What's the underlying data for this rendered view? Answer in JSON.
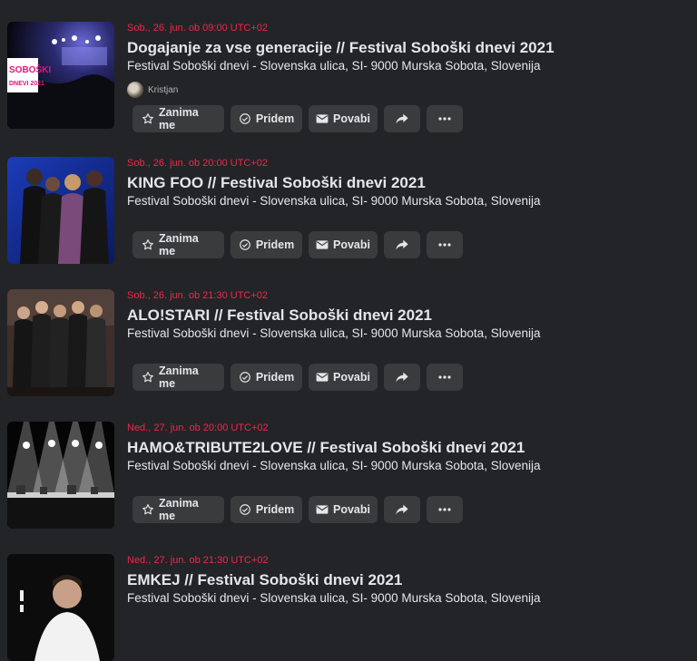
{
  "events": [
    {
      "date": "Sob., 26. jun. ob 09:00 UTC+02",
      "title": "Dogajanje za vse generacije // Festival Soboški dnevi 2021",
      "location": "Festival Soboški dnevi - Slovenska ulica, SI- 9000 Murska Sobota, Slovenija",
      "host": "Kristjan",
      "thumb_text": [
        "SOBOŠKI",
        "DNEVI 2021"
      ]
    },
    {
      "date": "Sob., 26. jun. ob 20:00 UTC+02",
      "title": "KING FOO // Festival Soboški dnevi 2021",
      "location": "Festival Soboški dnevi - Slovenska ulica, SI- 9000 Murska Sobota, Slovenija"
    },
    {
      "date": "Sob., 26. jun. ob 21:30 UTC+02",
      "title": "ALO!STARI // Festival Soboški dnevi 2021",
      "location": "Festival Soboški dnevi - Slovenska ulica, SI- 9000 Murska Sobota, Slovenija"
    },
    {
      "date": "Ned., 27. jun. ob 20:00 UTC+02",
      "title": "HAMO&TRIBUTE2LOVE // Festival Soboški dnevi 2021",
      "location": "Festival Soboški dnevi - Slovenska ulica, SI- 9000 Murska Sobota, Slovenija"
    },
    {
      "date": "Ned., 27. jun. ob 21:30 UTC+02",
      "title": "EMKEJ // Festival Soboški dnevi 2021",
      "location": "Festival Soboški dnevi - Slovenska ulica, SI- 9000 Murska Sobota, Slovenija"
    }
  ],
  "actions": {
    "interested": "Zanima me",
    "going": "Pridem",
    "invite": "Povabi"
  },
  "icons": {
    "interested": "star-icon",
    "going": "check-circle-icon",
    "invite": "envelope-icon",
    "share": "share-arrow-icon",
    "more": "more-dots-icon"
  },
  "colors": {
    "background": "#232427",
    "button": "#3a3b3c",
    "date": "#f0284a",
    "text": "#e4e6eb"
  }
}
